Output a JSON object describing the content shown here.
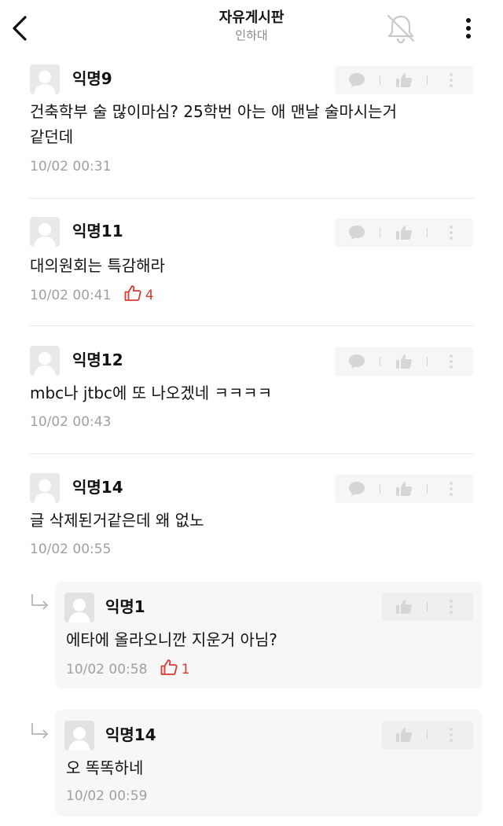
{
  "header": {
    "title": "자유게시판",
    "subtitle": "인하대",
    "back_icon": "chevron-left-icon",
    "notify_icon": "bell-off-icon",
    "more_icon": "more-vertical-icon"
  },
  "colors": {
    "like_red": "#d93a30",
    "meta_gray": "#a0a0a0",
    "reply_bg": "#f7f7f7"
  },
  "comments": [
    {
      "author": "익명9",
      "text_lines": [
        "건축학부 술 많이마심? 25학번 아는 애 맨날 술마시는거",
        "같던데"
      ],
      "time": "10/02 00:31",
      "likes": ""
    },
    {
      "author": "익명11",
      "text_lines": [
        "대의원회는 특감해라"
      ],
      "time": "10/02 00:41",
      "likes": "4"
    },
    {
      "author": "익명12",
      "text_lines": [
        "mbc나 jtbc에 또 나오겠네 ㅋㅋㅋㅋ"
      ],
      "time": "10/02 00:43",
      "likes": ""
    },
    {
      "author": "익명14",
      "text_lines": [
        "글 삭제된거같은데 왜 없노"
      ],
      "time": "10/02 00:55",
      "likes": ""
    }
  ],
  "replies": [
    {
      "author": "익명1",
      "text": "에타에 올라오니깐 지운거 아님?",
      "time": "10/02 00:58",
      "likes": "1"
    },
    {
      "author": "익명14",
      "text": "오 똑똑하네",
      "time": "10/02 00:59",
      "likes": ""
    }
  ]
}
